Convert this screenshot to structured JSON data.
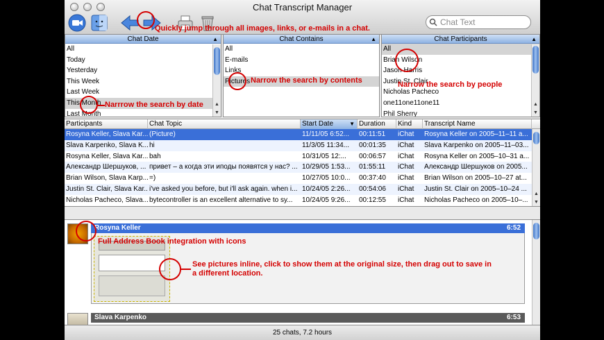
{
  "window": {
    "title": "Chat Transcript Manager"
  },
  "search": {
    "placeholder": "Chat Text"
  },
  "panes": {
    "chat_date": {
      "header": "Chat Date",
      "items": [
        "All",
        "Today",
        "Yesterday",
        "This Week",
        "Last Week",
        "This Month",
        "Last Month"
      ],
      "selected": "This Month"
    },
    "chat_contains": {
      "header": "Chat Contains",
      "items": [
        "All",
        "E-mails",
        "Links",
        "Pictures"
      ],
      "selected": "Pictures"
    },
    "chat_participants": {
      "header": "Chat Participants",
      "items": [
        "All",
        "Brian Wilson",
        "Jason Harris",
        "Justin St. Clair",
        "Nicholas Pacheco",
        "one11one11one11",
        "Phil Sherry"
      ],
      "selected": "All"
    }
  },
  "table": {
    "columns": [
      "Participants",
      "Chat Topic",
      "Start Date",
      "Duration",
      "Kind",
      "Transcript Name"
    ],
    "rows": [
      [
        "Rosyna Keller, Slava Kar...",
        "(Picture)",
        "11/11/05 6:52...",
        "00:11:51",
        "iChat",
        "Rosyna Keller on 2005–11–11 a..."
      ],
      [
        "Slava Karpenko, Slava K...",
        "hi",
        "11/3/05 11:34...",
        "00:01:35",
        "iChat",
        "Slava Karpenko on 2005–11–03..."
      ],
      [
        "Rosyna Keller, Slava Kar...",
        "bah",
        "10/31/05 12:...",
        "00:06:57",
        "iChat",
        "Rosyna Keller on 2005–10–31 a..."
      ],
      [
        "Александр Шершуков, ...",
        "привет – а когда эти иподы появятся у нас? ...",
        "10/29/05 1:53...",
        "01:55:11",
        "iChat",
        "Александр Шершуков on 2005..."
      ],
      [
        "Brian Wilson, Slava Karp...",
        "=)",
        "10/27/05 10:0...",
        "00:37:40",
        "iChat",
        "Brian Wilson on 2005–10–27 at..."
      ],
      [
        "Justin St. Clair, Slava Kar...",
        "i've asked you before, but i'll ask again. when i...",
        "10/24/05 2:26...",
        "00:54:06",
        "iChat",
        "Justin St. Clair on 2005–10–24 ..."
      ],
      [
        "Nicholas Pacheco, Slava...",
        "bytecontroller is an excellent alternative to sy...",
        "10/24/05 9:26...",
        "00:12:55",
        "iChat",
        "Nicholas Pacheco on 2005–10–..."
      ]
    ]
  },
  "transcript": {
    "messages": [
      {
        "name": "Rosyna Keller",
        "time": "6:52"
      },
      {
        "name": "Slava Karpenko",
        "time": "6:53"
      }
    ]
  },
  "status": {
    "text": "25 chats, 7.2 hours"
  },
  "annotations": {
    "jump": "Quickly jump through all images, links, or e-mails in a chat.",
    "contents": "Narrow the search by contents",
    "people": "Narrow the search by people",
    "date": "Narrrow the search by date",
    "address_book": "Full Address Book integration with icons",
    "pictures_1": "See pictures inline, click to show them at the original size, then drag out to save in",
    "pictures_2": "a different location."
  },
  "colors": {
    "annotation": "#d40000",
    "selection": "#3a6fd8",
    "header_blue": "#8fb3e3"
  },
  "icons": [
    "video-icon",
    "finder-icon",
    "previous-icon",
    "next-icon",
    "print-icon",
    "trash-icon",
    "search-icon"
  ]
}
